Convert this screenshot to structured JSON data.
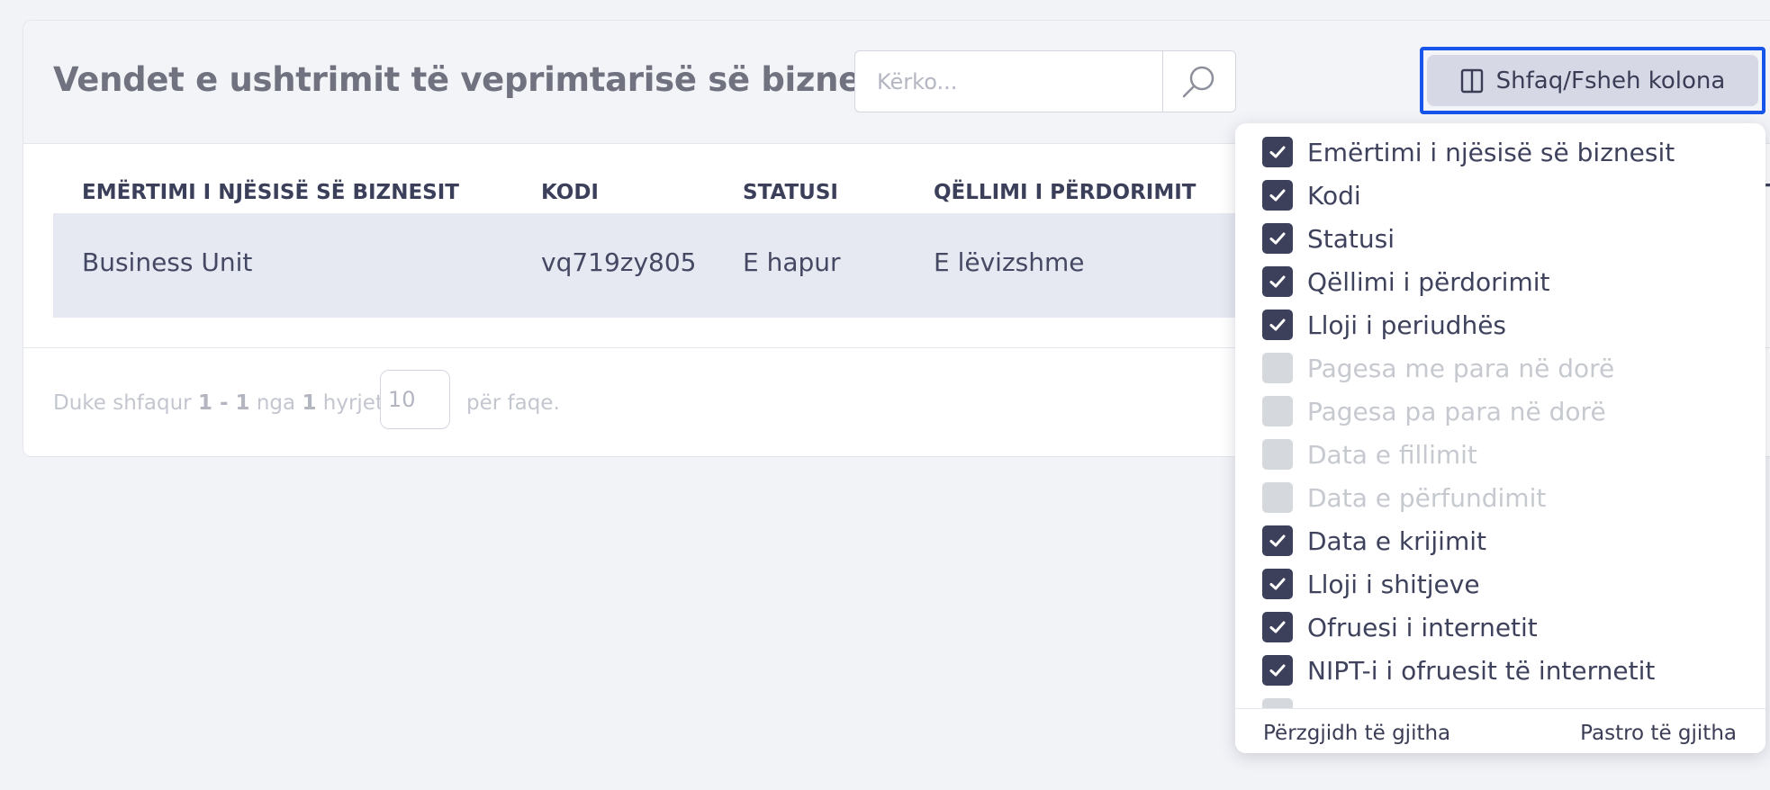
{
  "page": {
    "title": "Vendet e ushtrimit të veprimtarisë së biznesit"
  },
  "search": {
    "placeholder": "Kërko..."
  },
  "column_toggle": {
    "label": "Shfaq/Fsheh kolona"
  },
  "table": {
    "headers": [
      "EMËRTIMI I NJËSISË SË BIZNESIT",
      "KODI",
      "STATUSI",
      "QËLLIMI I PËRDORIMIT",
      "T"
    ],
    "rows": [
      {
        "name": "Business Unit",
        "code": "vq719zy805",
        "status": "E hapur",
        "purpose": "E lëvizshme"
      }
    ]
  },
  "pagination": {
    "prefix": "Duke shfaqur",
    "range": "1 - 1",
    "of": "nga",
    "total": "1",
    "entries": "hyrjet",
    "per_page_value": "10",
    "per_page_suffix": "për faqe."
  },
  "column_menu": {
    "items": [
      {
        "label": "Emërtimi i njësisë së biznesit",
        "checked": true
      },
      {
        "label": "Kodi",
        "checked": true
      },
      {
        "label": "Statusi",
        "checked": true
      },
      {
        "label": "Qëllimi i përdorimit",
        "checked": true
      },
      {
        "label": "Lloji i periudhës",
        "checked": true
      },
      {
        "label": "Pagesa me para në dorë",
        "checked": false
      },
      {
        "label": "Pagesa pa para në dorë",
        "checked": false
      },
      {
        "label": "Data e fillimit",
        "checked": false
      },
      {
        "label": "Data e përfundimit",
        "checked": false
      },
      {
        "label": "Data e krijimit",
        "checked": true
      },
      {
        "label": "Lloji i shitjeve",
        "checked": true
      },
      {
        "label": "Ofruesi i internetit",
        "checked": true
      },
      {
        "label": "NIPT-i i ofruesit të internetit",
        "checked": true
      },
      {
        "label": "",
        "checked": false
      }
    ],
    "select_all": "Përzgjidh të gjitha",
    "clear_all": "Pastro të gjitha"
  },
  "colors": {
    "accent_outline": "#1654ea",
    "checkbox_checked": "#3c405b",
    "checkbox_unchecked": "#d5d8dd"
  }
}
